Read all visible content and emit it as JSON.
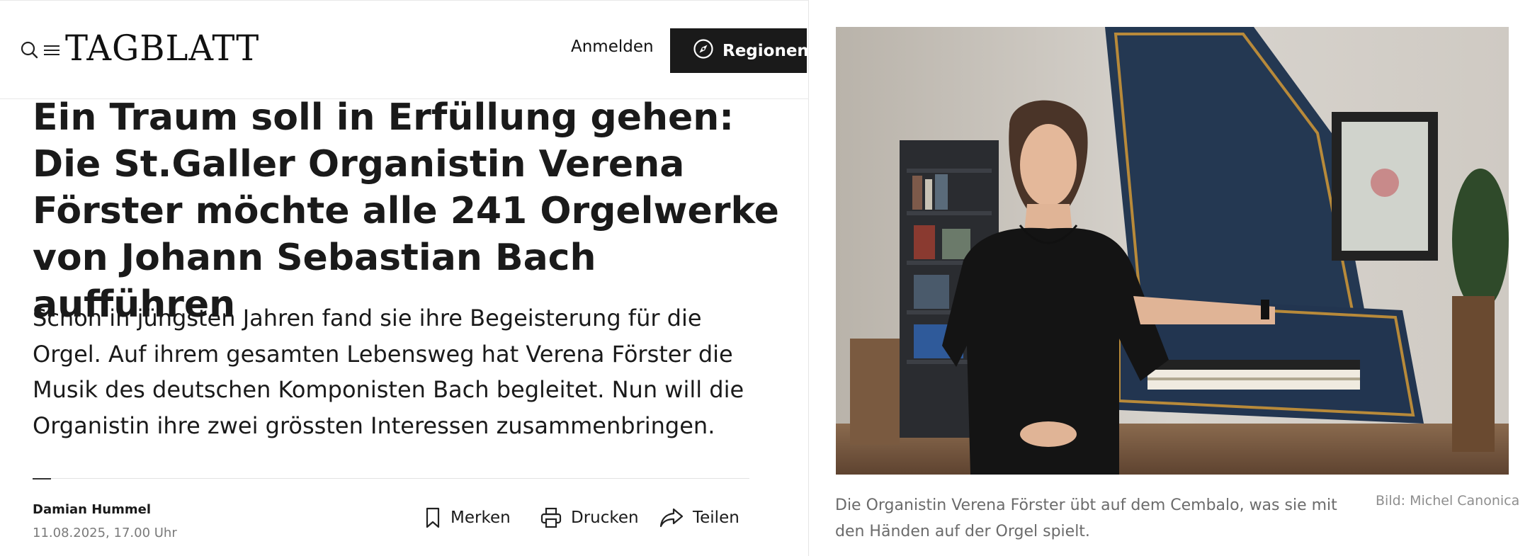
{
  "header": {
    "logo_text": "TAGBLATT",
    "login_label": "Anmelden",
    "regions_label": "Regionen"
  },
  "article": {
    "headline": "Ein Traum soll in Erfüllung gehen: Die St.Galler Organistin Verena Förster möchte alle 241 Orgelwerke von Johann Sebastian Bach aufführen",
    "lead": "Schon in jüngsten Jahren fand sie ihre Begeisterung für die Orgel. Auf ihrem gesamten Lebensweg hat Verena Förster die Musik des deutschen Komponisten Bach begleitet. Nun will die Organistin ihre zwei grössten Interessen zusammenbringen.",
    "author": "Damian Hummel",
    "date": "11.08.2025, 17.00 Uhr"
  },
  "actions": {
    "bookmark_label": "Merken",
    "print_label": "Drucken",
    "share_label": "Teilen"
  },
  "image": {
    "caption": "Die Organistin Verena Förster übt auf dem Cembalo, was sie mit den Händen auf der Orgel spielt.",
    "credit": "Bild: Michel Canonica"
  },
  "icons": [
    "search-icon",
    "menu-icon",
    "compass-icon",
    "bookmark-icon",
    "print-icon",
    "share-icon"
  ],
  "colors": {
    "button_bg": "#1a1a1a",
    "text": "#1a1a1a",
    "muted": "#7a7a7a"
  }
}
